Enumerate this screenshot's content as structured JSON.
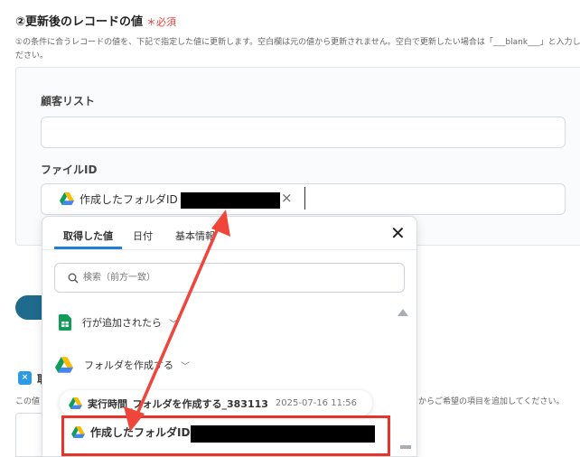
{
  "section": {
    "title": "②更新後のレコードの値",
    "required_mark": "＊必須",
    "description_line1": "①の条件に合うレコードの値を、下記で指定した値に更新します。空白欄は元の値から更新されません。空白で更新したい場合は「___blank___」と入力して",
    "description_line2": "ださい。"
  },
  "fields": {
    "customer_list": {
      "label": "顧客リスト",
      "value": ""
    },
    "file_id": {
      "label": "ファイルID",
      "token_label": "作成したフォルダID",
      "token_icon": "google-drive-icon"
    }
  },
  "popup": {
    "tabs": [
      "取得した値",
      "日付",
      "基本情報"
    ],
    "active_tab": 0,
    "search_placeholder": "検索（前方一致）",
    "groups": [
      {
        "icon": "google-sheets-icon",
        "label": "行が追加されたら"
      },
      {
        "icon": "google-drive-icon",
        "label": "フォルダを作成する"
      }
    ],
    "items": [
      {
        "icon": "google-drive-icon",
        "label": "実行時間_フォルダを作成する_383113",
        "timestamp": "2025-07-16 11:56"
      },
      {
        "icon": "google-drive-icon",
        "label": "作成したフォルダID"
      }
    ]
  },
  "background": {
    "left_text": "この値",
    "right_text": "からご希望の項目を追加してください。",
    "partial_heading": "取"
  },
  "colors": {
    "accent": "#1f7fd4",
    "required": "#e0443c",
    "highlight": "#e8332b",
    "arrow": "#f0453a"
  }
}
